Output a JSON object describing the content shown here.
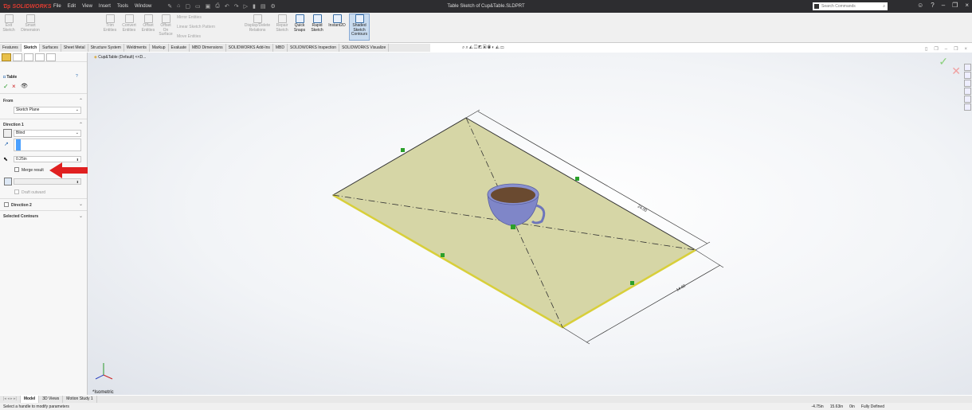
{
  "app": {
    "logo_ds": "Ɗʂ",
    "logo_brand": "SOLIDWORKS",
    "document_title": "Table Sketch of Cup&Table.SLDPRT",
    "menus": [
      "File",
      "Edit",
      "View",
      "Insert",
      "Tools",
      "Window"
    ],
    "search_placeholder": "Search Commands"
  },
  "command_manager": {
    "tools": [
      {
        "label": "Exit\nSketch",
        "enabled": false
      },
      {
        "label": "Smart\nDimension",
        "enabled": false
      },
      {
        "label": "Trim\nEntities",
        "enabled": false
      },
      {
        "label": "Convert\nEntities",
        "enabled": false
      },
      {
        "label": "Offset\nEntities",
        "enabled": false
      },
      {
        "label": "Offset\nOn\nSurface",
        "enabled": false
      },
      {
        "label": "Display/Delete\nRelations",
        "enabled": false
      },
      {
        "label": "Repair\nSketch",
        "enabled": false
      },
      {
        "label": "Quick\nSnaps",
        "enabled": true
      },
      {
        "label": "Rapid\nSketch",
        "enabled": true
      },
      {
        "label": "Instant2D",
        "enabled": true
      },
      {
        "label": "Shaded\nSketch\nContours",
        "enabled": true,
        "active": true
      }
    ],
    "row_tools": [
      "Mirror Entities",
      "Linear Sketch Pattern",
      "Move Entities"
    ]
  },
  "tabs": [
    "Features",
    "Sketch",
    "Surfaces",
    "Sheet Metal",
    "Structure System",
    "Weldments",
    "Markup",
    "Evaluate",
    "MBD Dimensions",
    "SOLIDWORKS Add-Ins",
    "MBD",
    "SOLIDWORKS Inspection",
    "SOLIDWORKS Visualize"
  ],
  "selected_tab": "Sketch",
  "tree_item": "Cup&Table (Default) <<D...",
  "property_manager": {
    "title": "Table",
    "from_label": "From",
    "from_value": "Sketch Plane",
    "direction1_label": "Direction 1",
    "end_condition": "Blind",
    "depth": "0.25in",
    "merge_result": "Merge result",
    "draft_outward": "Draft outward",
    "direction2_label": "Direction 2",
    "selected_contours": "Selected Contours"
  },
  "viewport": {
    "dim_long": "24.00",
    "dim_short": "14.00",
    "view_label": "*Isometric"
  },
  "bottom_tabs": [
    "Model",
    "3D Views",
    "Motion Study 1"
  ],
  "status": {
    "message": "Select a handle to modify parameters",
    "x": "-4.75in",
    "y": "15.63in",
    "z": "0in",
    "state": "Fully Defined"
  }
}
